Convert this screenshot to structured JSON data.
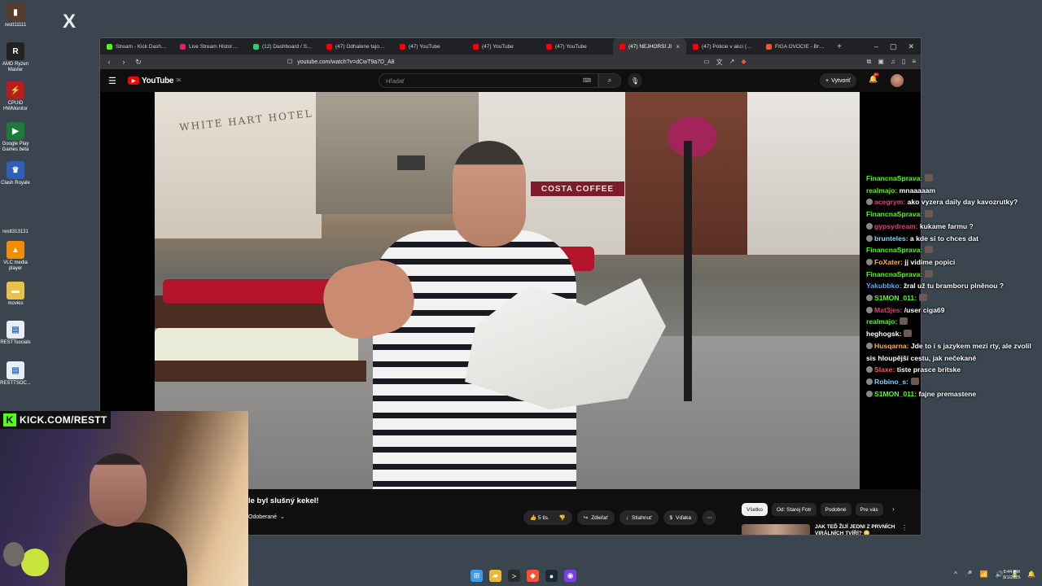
{
  "desktop": {
    "icons": [
      {
        "label": "restt11111",
        "color": "#5a3a2a",
        "glyph": "▮"
      },
      {
        "label": "AMD Ryzen Master",
        "color": "#222",
        "glyph": "R"
      },
      {
        "label": "CPUID HWMonitor",
        "color": "#b61e1e",
        "glyph": "⚡"
      },
      {
        "label": "Google Play Games beta",
        "color": "#1f7a3a",
        "glyph": "▶"
      },
      {
        "label": "Clash Royale",
        "color": "#2d5fb8",
        "glyph": "♛"
      },
      {
        "label": "restt313131",
        "color": "#3a4550",
        "glyph": ""
      },
      {
        "label": "VLC media player",
        "color": "#f28c00",
        "glyph": "▲"
      },
      {
        "label": "movies",
        "color": "#e8c14a",
        "glyph": "▬"
      },
      {
        "label": "RESTTsocials",
        "color": "#e9eef5",
        "glyph": "▤"
      },
      {
        "label": "RESTTSOC...",
        "color": "#e9eef5",
        "glyph": "▤"
      }
    ],
    "x_logo": "X"
  },
  "browser": {
    "tabs": [
      {
        "label": "Stream - Kick Dashboard",
        "color": "#53fc18",
        "active": false
      },
      {
        "label": "Live Stream History for R",
        "color": "#e91e63",
        "active": false
      },
      {
        "label": "(12) Dashboard / Stream",
        "color": "#2ecc71",
        "active": false
      },
      {
        "label": "(47) Odhalene tajomstvo",
        "color": "#ff0000",
        "active": false
      },
      {
        "label": "(47) YouTube",
        "color": "#ff0000",
        "active": false
      },
      {
        "label": "(47) YouTube",
        "color": "#ff0000",
        "active": false
      },
      {
        "label": "(47) YouTube",
        "color": "#ff0000",
        "active": false
      },
      {
        "label": "(47) NEJHORŠÍ JÍ",
        "color": "#ff0000",
        "active": true
      },
      {
        "label": "(47) Policie v akci (334)",
        "color": "#ff0000",
        "active": false
      },
      {
        "label": "FIGA OVOCIE - Brave Se",
        "color": "#fb542b",
        "active": false
      }
    ],
    "tab_close": "×",
    "new_tab": "+",
    "window_controls": [
      "–",
      "▢",
      "✕"
    ],
    "url": "youtube.com/watch?v=dCwT9a7D_A8",
    "nav": {
      "back": "‹",
      "forward": "›",
      "reload": "↻",
      "bookmark": "☐"
    }
  },
  "youtube": {
    "logo_text": "YouTube",
    "logo_region": "SK",
    "search_placeholder": "Hľadať",
    "create_label": "Vytvoriť",
    "notif_count": "9+",
    "video_title": "le byl slušný kekel!",
    "subscribe_label": "Odoberané",
    "actions": {
      "likes": "5 tis.",
      "share": "Zdieľať",
      "download": "Stiahnuť",
      "thanks": "Vďaka"
    },
    "chips": [
      "Všetko",
      "Od: Starej Fotr",
      "Podobné",
      "Pre vás"
    ],
    "recommendation_title": "JAK TEĎ ŽIJÍ JEDNI Z PRVNÍCH VIRÁLNÍCH TVÍŘÍ? 😳",
    "video_scene": {
      "costa_sign": "COSTA COFFEE",
      "building_sign": "WHITE HART HOTEL"
    }
  },
  "chat": [
    {
      "user": "FinancnaSprava",
      "color": "#53fc18",
      "msg": "",
      "emote": true,
      "badge": false
    },
    {
      "user": "realmajo",
      "color": "#53fc18",
      "msg": "mnaaaaam",
      "emote": false,
      "badge": false
    },
    {
      "user": "acegrym",
      "color": "#e0447a",
      "msg": "ako vyzera daily day kavozrutky?",
      "emote": false,
      "badge": true
    },
    {
      "user": "FinancnaSprava",
      "color": "#53fc18",
      "msg": "",
      "emote": true,
      "badge": false
    },
    {
      "user": "gypsydream",
      "color": "#e0447a",
      "msg": "kukame farmu ?",
      "emote": false,
      "badge": true
    },
    {
      "user": "brunteles",
      "color": "#7fd7ff",
      "msg": "a kde si to chces dat",
      "emote": false,
      "badge": true
    },
    {
      "user": "FinancnaSprava",
      "color": "#53fc18",
      "msg": "",
      "emote": true,
      "badge": false
    },
    {
      "user": "FoXater",
      "color": "#ffb347",
      "msg": "jj vidime popici",
      "emote": false,
      "badge": true
    },
    {
      "user": "FinancnaSprava",
      "color": "#53fc18",
      "msg": "",
      "emote": true,
      "badge": false
    },
    {
      "user": "Yakubbko",
      "color": "#5aa9ff",
      "msg": "žral už tu bramboru plněnou ?",
      "emote": false,
      "badge": false
    },
    {
      "user": "S1MON_011",
      "color": "#53fc18",
      "msg": "",
      "emote": true,
      "badge": true
    },
    {
      "user": "Mat3jes",
      "color": "#e0447a",
      "msg": "/user ciga69",
      "emote": false,
      "badge": true
    },
    {
      "user": "realmajo",
      "color": "#53fc18",
      "msg": "",
      "emote": true,
      "badge": false
    },
    {
      "user": "heghogsk",
      "color": "#ffffff",
      "msg": "",
      "emote": true,
      "badge": false
    },
    {
      "user": "Husqarna",
      "color": "#ffb347",
      "msg": "Jde to i s jazykem mezi rty, ale zvolil sis hloupější cestu, jak nečekané",
      "emote": false,
      "badge": true
    },
    {
      "user": "Slaxe",
      "color": "#ff5a5a",
      "msg": "tiste prasce britske",
      "emote": false,
      "badge": true
    },
    {
      "user": "Robino_s",
      "color": "#7fd7ff",
      "msg": "",
      "emote": true,
      "badge": true
    },
    {
      "user": "S1MON_011",
      "color": "#53fc18",
      "msg": "fajne premastene",
      "emote": false,
      "badge": true
    }
  ],
  "overlay": {
    "kick_url": "KICK.COM/RESTT",
    "kick_letter": "K"
  },
  "taskbar": {
    "icons": [
      {
        "name": "windows-start-icon",
        "color": "#3c9be8",
        "glyph": "⊞"
      },
      {
        "name": "file-explorer-icon",
        "color": "#e8b73c",
        "glyph": "▰"
      },
      {
        "name": "terminal-icon",
        "color": "#2b2b2b",
        "glyph": ">"
      },
      {
        "name": "brave-icon",
        "color": "#fb542b",
        "glyph": "◆"
      },
      {
        "name": "steam-icon",
        "color": "#1b2838",
        "glyph": "●"
      },
      {
        "name": "app-icon",
        "color": "#7b3fe4",
        "glyph": "◉"
      }
    ],
    "tray": [
      "^",
      "🎤",
      "📶",
      "🔊",
      "🔋"
    ],
    "time": "9:44 PM",
    "date": "9/1/2025",
    "notif_glyph": "🔔"
  }
}
